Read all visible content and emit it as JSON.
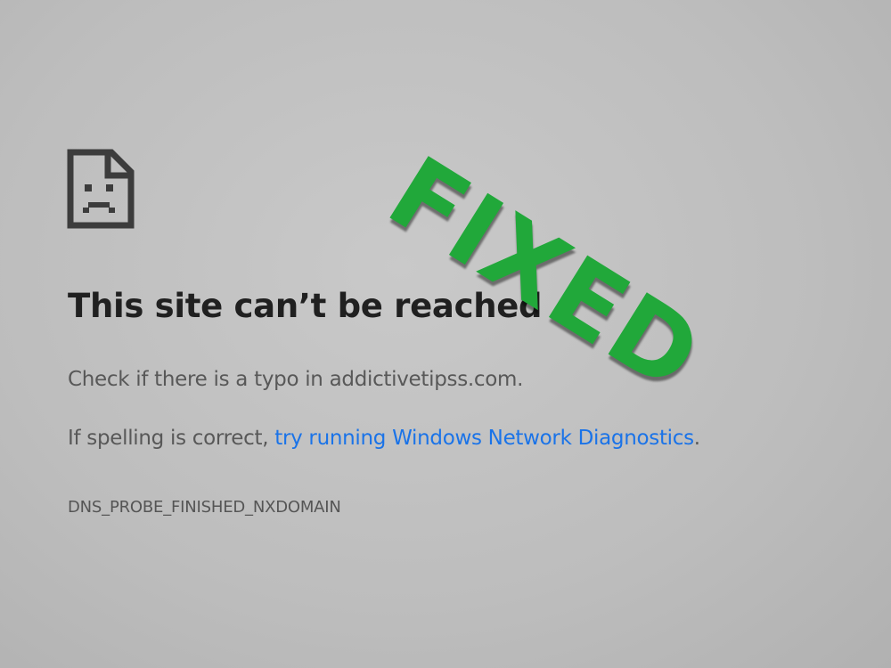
{
  "error_page": {
    "icon": "sad-page-icon",
    "title": "This site can’t be reached",
    "message_typo": "Check if there is a typo in addictivetipss.com.",
    "message_spelling_prefix": "If spelling is correct, ",
    "diagnostics_link": "try running Windows Network Diagnostics",
    "message_spelling_suffix": ".",
    "error_code": "DNS_PROBE_FINISHED_NXDOMAIN",
    "link_color": "#1a73e8"
  },
  "overlay": {
    "stamp_text": "FIXED",
    "stamp_color": "#21a83a"
  }
}
